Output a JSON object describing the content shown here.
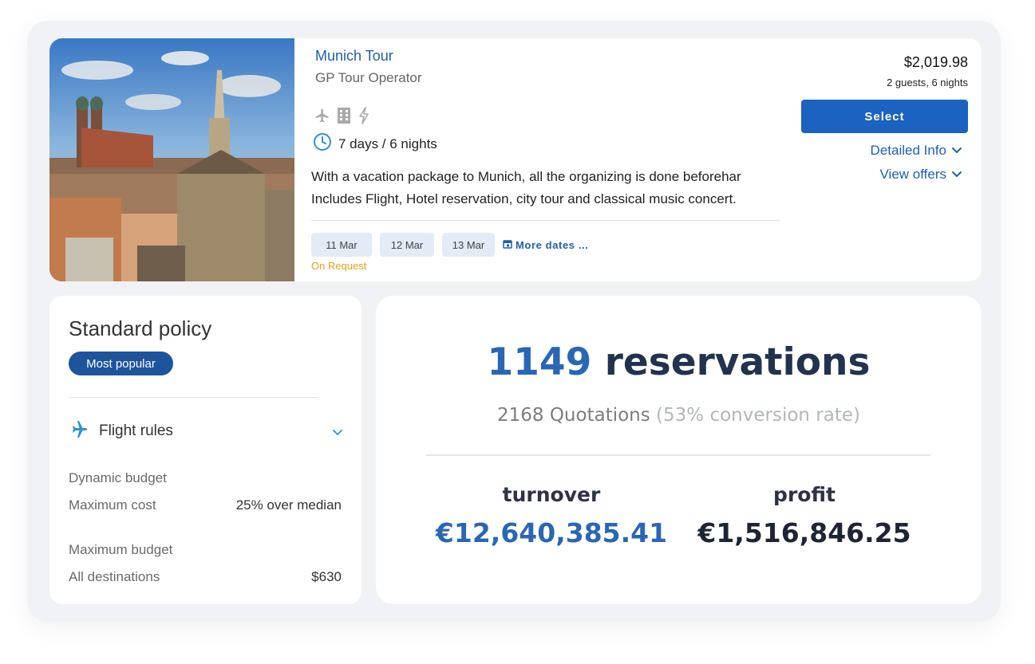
{
  "tour": {
    "title": "Munich Tour",
    "operator": "GP Tour Operator",
    "amenity_icons": [
      "plane-icon",
      "hotel-icon",
      "lightning-icon"
    ],
    "duration": "7 days / 6 nights",
    "description_line1": "With a vacation package to Munich, all the organizing is done beforehar",
    "description_line2": "Includes Flight, Hotel reservation, city tour and classical music concert.",
    "dates": [
      "11 Mar",
      "12 Mar",
      "13 Mar"
    ],
    "more_dates": "More dates ...",
    "availability": "On Request",
    "price": "$2,019.98",
    "price_details": "2 guests, 6 nights",
    "select_label": "Select",
    "detailed_info_label": "Detailed Info",
    "view_offers_label": "View offers"
  },
  "policy": {
    "title": "Standard policy",
    "badge": "Most popular",
    "rules_label": "Flight rules",
    "dynamic_budget_label": "Dynamic budget",
    "max_cost_label": "Maximum cost",
    "max_cost_value": "25% over median",
    "max_budget_label": "Maximum budget",
    "all_destinations_label": "All destinations",
    "all_destinations_value": "$630"
  },
  "stats": {
    "reservations_count": "1149",
    "reservations_label": "reservations",
    "quotations": "2168 Quotations",
    "conversion": "(53% conversion rate)",
    "turnover_label": "turnover",
    "turnover_value": "€12,640,385.41",
    "profit_label": "profit",
    "profit_value": "€1,516,846.25"
  },
  "colors": {
    "accent": "#1c62c0",
    "link": "#1f5fb4",
    "badge": "#1e549c",
    "on_request": "#e8a11a",
    "clock": "#2f8fd6",
    "plane_rule_icon": "#2f8fd6"
  }
}
